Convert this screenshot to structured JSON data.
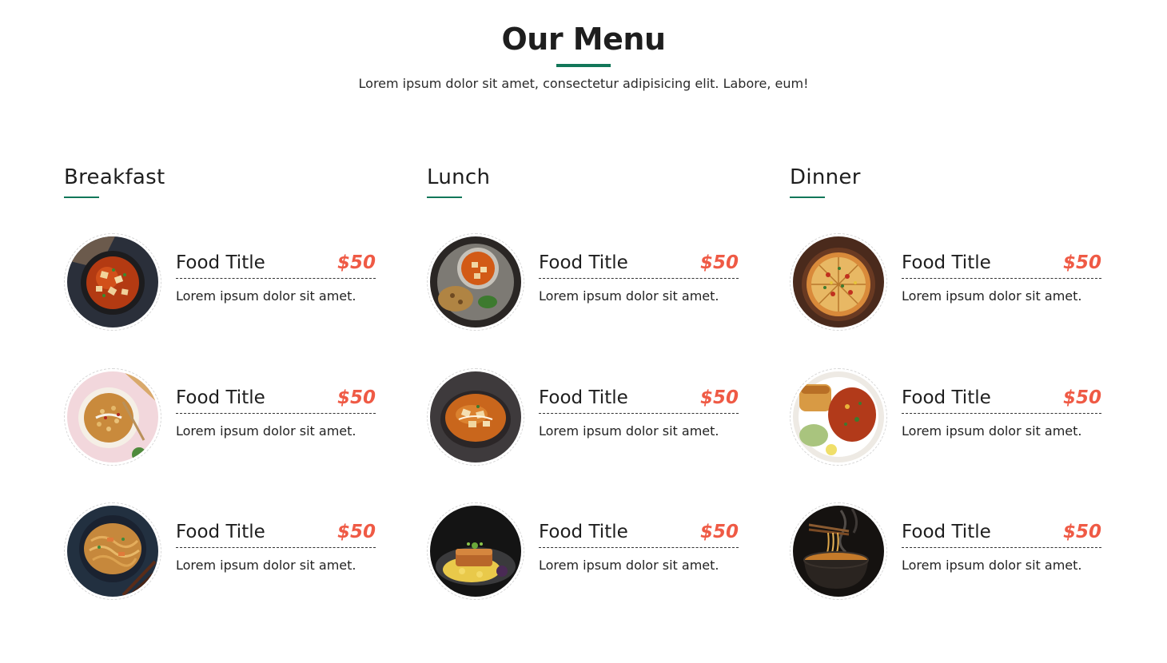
{
  "header": {
    "title": "Our Menu",
    "subtitle": "Lorem ipsum dolor sit amet, consectetur adipisicing elit. Labore, eum!"
  },
  "colors": {
    "accent": "#127759",
    "price": "#ef5a45",
    "text": "#1e1e1e"
  },
  "categories": [
    {
      "name": "Breakfast",
      "items": [
        {
          "title": "Food Title",
          "price": "$50",
          "desc": "Lorem ipsum dolor sit amet.",
          "image": "paneer-curry-bowl-image"
        },
        {
          "title": "Food Title",
          "price": "$50",
          "desc": "Lorem ipsum dolor sit amet.",
          "image": "chana-bowl-image"
        },
        {
          "title": "Food Title",
          "price": "$50",
          "desc": "Lorem ipsum dolor sit amet.",
          "image": "noodles-plate-image"
        }
      ]
    },
    {
      "name": "Lunch",
      "items": [
        {
          "title": "Food Title",
          "price": "$50",
          "desc": "Lorem ipsum dolor sit amet.",
          "image": "paneer-thali-image"
        },
        {
          "title": "Food Title",
          "price": "$50",
          "desc": "Lorem ipsum dolor sit amet.",
          "image": "butter-paneer-image"
        },
        {
          "title": "Food Title",
          "price": "$50",
          "desc": "Lorem ipsum dolor sit amet.",
          "image": "grilled-fish-image"
        }
      ]
    },
    {
      "name": "Dinner",
      "items": [
        {
          "title": "Food Title",
          "price": "$50",
          "desc": "Lorem ipsum dolor sit amet.",
          "image": "pizza-image"
        },
        {
          "title": "Food Title",
          "price": "$50",
          "desc": "Lorem ipsum dolor sit amet.",
          "image": "pav-bhaji-image"
        },
        {
          "title": "Food Title",
          "price": "$50",
          "desc": "Lorem ipsum dolor sit amet.",
          "image": "ramen-bowl-image"
        }
      ]
    }
  ]
}
